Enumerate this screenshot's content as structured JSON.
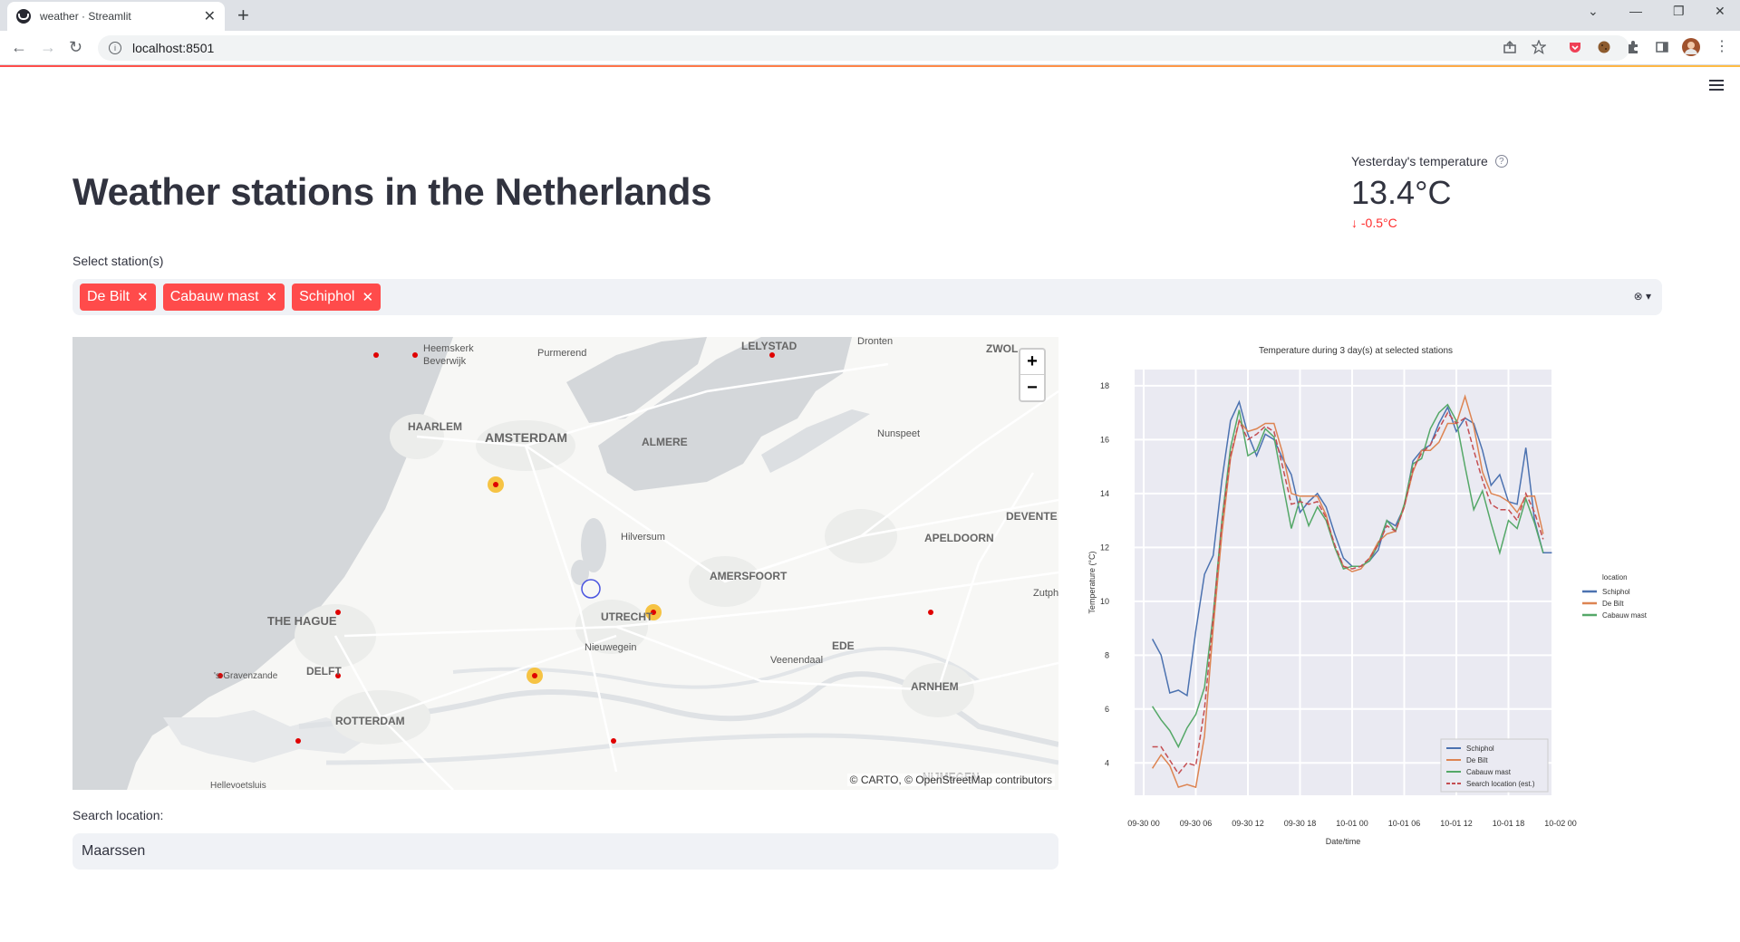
{
  "browser": {
    "tab_title": "weather · Streamlit",
    "url": "localhost:8501"
  },
  "page": {
    "title": "Weather stations in the Netherlands",
    "metric": {
      "label": "Yesterday's temperature",
      "value": "13.4°C",
      "delta": "-0.5°C"
    },
    "select_label": "Select station(s)",
    "selected_stations": [
      "De Bilt",
      "Cabauw mast",
      "Schiphol"
    ],
    "search_label": "Search location:",
    "search_value": "Maarssen"
  },
  "map": {
    "attribution": "© CARTO, © OpenStreetMap contributors",
    "labels": [
      {
        "text": "Heemskerk",
        "size": 11
      },
      {
        "text": "Beverwijk",
        "size": 11
      },
      {
        "text": "Purmerend",
        "size": 11
      },
      {
        "text": "LELYSTAD",
        "size": 12
      },
      {
        "text": "Dronten",
        "size": 11
      },
      {
        "text": "ZWOL",
        "size": 12
      },
      {
        "text": "HAARLEM",
        "size": 12
      },
      {
        "text": "AMSTERDAM",
        "size": 14
      },
      {
        "text": "ALMERE",
        "size": 12
      },
      {
        "text": "Nunspeet",
        "size": 11
      },
      {
        "text": "DEVENTE",
        "size": 12
      },
      {
        "text": "Hilversum",
        "size": 11
      },
      {
        "text": "APELDOORN",
        "size": 12
      },
      {
        "text": "AMERSFOORT",
        "size": 12
      },
      {
        "text": "Zutph",
        "size": 11
      },
      {
        "text": "THE HAGUE",
        "size": 13
      },
      {
        "text": "UTRECHT",
        "size": 12
      },
      {
        "text": "EDE",
        "size": 12
      },
      {
        "text": "'s-Gravenzande",
        "size": 10
      },
      {
        "text": "DELFT",
        "size": 12
      },
      {
        "text": "Nieuwegein",
        "size": 11
      },
      {
        "text": "Veenendaal",
        "size": 11
      },
      {
        "text": "ARNHEM",
        "size": 12
      },
      {
        "text": "ROTTERDAM",
        "size": 12
      },
      {
        "text": "NIJMEGEN",
        "size": 12
      },
      {
        "text": "Hellevoetsluis",
        "size": 10
      }
    ]
  },
  "chart_data": {
    "type": "line",
    "title": "Temperature during 3 day(s) at selected stations",
    "xlabel": "Date/time",
    "ylabel": "Temperature (°C)",
    "x_tick_labels": [
      "09-30 00",
      "09-30 06",
      "09-30 12",
      "09-30 18",
      "10-01 00",
      "10-01 06",
      "10-01 12",
      "10-01 18",
      "10-02 00"
    ],
    "y_ticks": [
      4,
      6,
      8,
      10,
      12,
      14,
      16,
      18
    ],
    "ylim": [
      2.8,
      18.6
    ],
    "x_hours": [
      1,
      2,
      3,
      4,
      5,
      6,
      7,
      8,
      9,
      10,
      11,
      12,
      13,
      14,
      15,
      16,
      17,
      18,
      19,
      20,
      21,
      22,
      23,
      24,
      25,
      26,
      27,
      28,
      29,
      30,
      31,
      32,
      33,
      34,
      35,
      36,
      37,
      38,
      39,
      40,
      41,
      42,
      43,
      44,
      45,
      46,
      47,
      48,
      49
    ],
    "series": [
      {
        "name": "Schiphol",
        "color": "#4c72b0",
        "dash": false,
        "values": [
          8.6,
          8.0,
          6.6,
          6.7,
          6.5,
          8.9,
          11.0,
          11.7,
          14.5,
          16.7,
          17.4,
          16.2,
          15.4,
          16.2,
          16.0,
          15.3,
          14.7,
          13.3,
          13.7,
          14.0,
          13.5,
          12.5,
          11.6,
          11.3,
          11.3,
          11.5,
          11.9,
          13.0,
          12.8,
          13.5,
          15.2,
          15.6,
          15.8,
          16.6,
          17.2,
          16.3,
          16.8,
          16.6,
          15.6,
          14.3,
          14.7,
          13.7,
          13.6,
          15.7,
          13.0,
          11.8,
          11.8
        ]
      },
      {
        "name": "De Bilt",
        "color": "#dd8452",
        "dash": false,
        "values": [
          3.8,
          4.3,
          3.9,
          3.1,
          3.2,
          3.1,
          5.0,
          9.0,
          12.5,
          15.3,
          16.7,
          16.3,
          16.4,
          16.6,
          16.6,
          15.5,
          14.0,
          13.9,
          13.9,
          13.9,
          13.2,
          12.0,
          11.3,
          11.1,
          11.2,
          11.6,
          12.2,
          12.5,
          12.6,
          13.5,
          14.8,
          15.6,
          15.6,
          15.9,
          16.6,
          16.6,
          17.6,
          16.5,
          14.8,
          14.0,
          13.9,
          13.7,
          13.3,
          13.9,
          13.9,
          12.5
        ]
      },
      {
        "name": "Cabauw mast",
        "color": "#55a868",
        "dash": false,
        "values": [
          6.1,
          5.6,
          5.2,
          4.6,
          5.3,
          5.8,
          6.8,
          9.5,
          13.0,
          15.7,
          17.1,
          15.4,
          15.6,
          16.4,
          16.1,
          14.4,
          12.7,
          13.8,
          12.8,
          13.5,
          13.0,
          12.0,
          11.2,
          11.3,
          11.3,
          11.5,
          12.1,
          13.0,
          12.6,
          13.6,
          15.1,
          15.3,
          16.4,
          17.0,
          17.3,
          16.7,
          15.0,
          13.4,
          14.1,
          12.9,
          11.8,
          13.0,
          12.7,
          13.8,
          12.9,
          11.8
        ]
      },
      {
        "name": "Search location (est.)",
        "color": "#c44e52",
        "dash": true,
        "values": [
          4.6,
          4.6,
          4.1,
          3.6,
          4.0,
          3.9,
          6.0,
          9.4,
          12.9,
          15.4,
          16.7,
          16.0,
          16.2,
          16.5,
          16.3,
          15.0,
          13.6,
          13.7,
          13.6,
          13.7,
          13.1,
          12.1,
          11.3,
          11.2,
          11.3,
          11.6,
          12.1,
          12.8,
          12.6,
          13.5,
          14.9,
          15.5,
          15.8,
          16.4,
          17.0,
          16.6,
          16.8,
          15.6,
          14.5,
          13.6,
          13.4,
          13.4,
          13.0,
          14.0,
          13.3,
          12.3
        ]
      }
    ],
    "legend_title": "location",
    "legend_outside": [
      "Schiphol",
      "De Bilt",
      "Cabauw mast"
    ],
    "legend_inside": [
      "Schiphol",
      "De Bilt",
      "Cabauw mast",
      "Search location (est.)"
    ],
    "legend_inside_placement": "lower-right",
    "grid": true
  }
}
